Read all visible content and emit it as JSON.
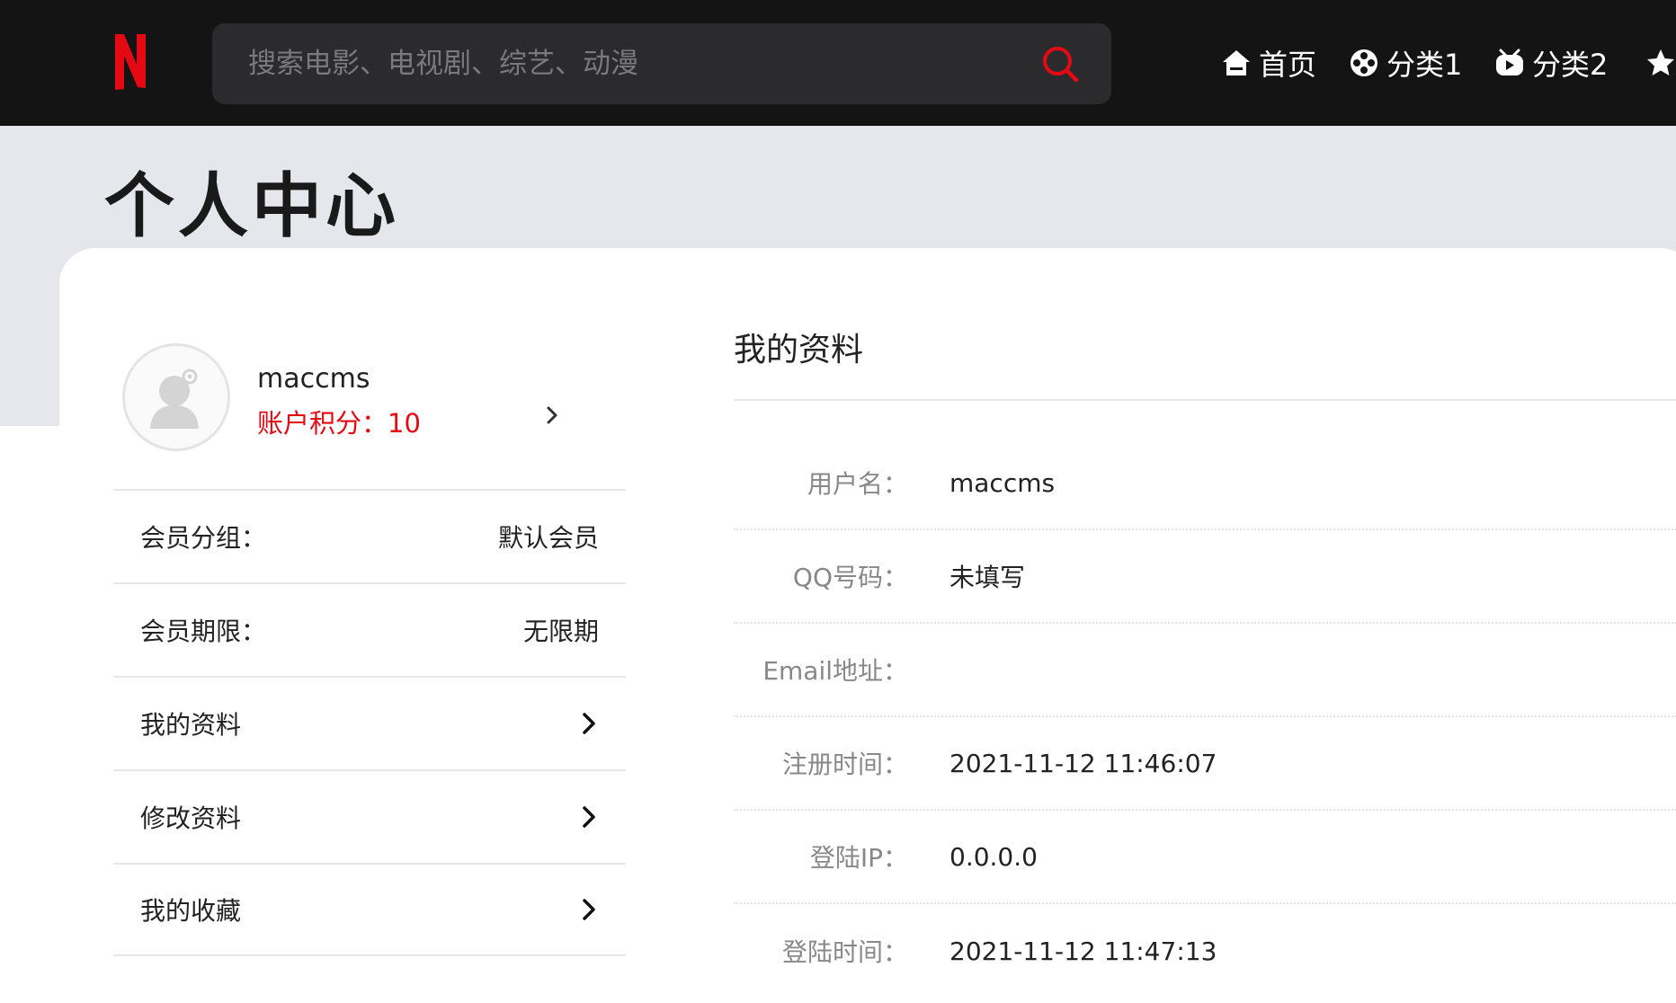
{
  "header": {
    "logo_letter": "N",
    "brand_color": "#e50914",
    "search_placeholder": "搜索电影、电视剧、综艺、动漫",
    "nav": [
      {
        "label": "首页",
        "icon": "home-icon"
      },
      {
        "label": "分类1",
        "icon": "film-reel-icon"
      },
      {
        "label": "分类2",
        "icon": "tv-icon"
      },
      {
        "label": "",
        "icon": "star-icon"
      }
    ]
  },
  "page_title": "个人中心",
  "profile": {
    "username": "maccms",
    "points_label": "账户积分：",
    "points_value": "10"
  },
  "left_menu": [
    {
      "label": "会员分组：",
      "value": "默认会员"
    },
    {
      "label": "会员期限：",
      "value": "无限期"
    },
    {
      "label": "我的资料"
    },
    {
      "label": "修改资料"
    },
    {
      "label": "我的收藏"
    }
  ],
  "details": {
    "title": "我的资料",
    "rows": [
      {
        "label": "用户名：",
        "value": "maccms"
      },
      {
        "label": "QQ号码：",
        "value": "未填写"
      },
      {
        "label": "Email地址：",
        "value": ""
      },
      {
        "label": "注册时间：",
        "value": "2021-11-12 11:46:07"
      },
      {
        "label": "登陆IP：",
        "value": "0.0.0.0"
      },
      {
        "label": "登陆时间：",
        "value": "2021-11-12 11:47:13"
      }
    ]
  }
}
